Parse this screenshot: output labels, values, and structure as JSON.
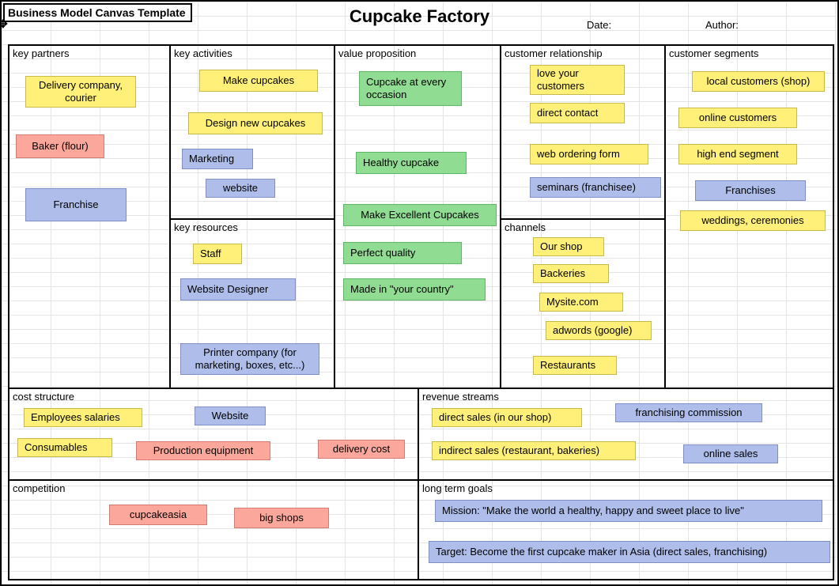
{
  "templateLabel": "Business Model Canvas Template",
  "title": "Cupcake Factory",
  "dateLabel": "Date:",
  "authorLabel": "Author:",
  "sections": {
    "keyPartners": "key partners",
    "keyActivities": "key activities",
    "keyResources": "key resources",
    "valueProposition": "value proposition",
    "customerRelationship": "customer relationship",
    "channels": "channels",
    "customerSegments": "customer segments",
    "costStructure": "cost structure",
    "revenueStreams": "revenue streams",
    "competition": "competition",
    "longTermGoals": "long term goals"
  },
  "notes": {
    "kp1": "Delivery company, courier",
    "kp2": "Baker (flour)",
    "kp3": "Franchise",
    "ka1": "Make cupcakes",
    "ka2": "Design new cupcakes",
    "ka3": "Marketing",
    "ka4": "website",
    "kr1": "Staff",
    "kr2": "Website Designer",
    "kr3": "Printer company (for marketing, boxes, etc...)",
    "vp1": "Cupcake at every occasion",
    "vp2": "Healthy cupcake",
    "vp3": "Make Excellent Cupcakes",
    "vp4": "Perfect quality",
    "vp5": "Made in \"your country\"",
    "cr1": "love your customers",
    "cr2": "direct contact",
    "cr3": "web ordering form",
    "cr4": "seminars (franchisee)",
    "ch1": "Our shop",
    "ch2": "Backeries",
    "ch3": "Mysite.com",
    "ch4": "adwords (google)",
    "ch5": "Restaurants",
    "cs1": "local customers (shop)",
    "cs2": "online customers",
    "cs3": "high end segment",
    "cs4": "Franchises",
    "cs5": "weddings, ceremonies",
    "co1": "Employees salaries",
    "co2": "Consumables",
    "co3": "Production equipment",
    "co4": "Website",
    "co5": "delivery cost",
    "rs1": "direct sales (in our shop)",
    "rs2": "indirect sales (restaurant, bakeries)",
    "rs3": "franchising commission",
    "rs4": "online sales",
    "cm1": "cupcakeasia",
    "cm2": "big shops",
    "lt1": "Mission: \"Make the world a healthy, happy and sweet place to live\"",
    "lt2": "Target: Become the first cupcake maker in Asia (direct sales, franchising)"
  }
}
